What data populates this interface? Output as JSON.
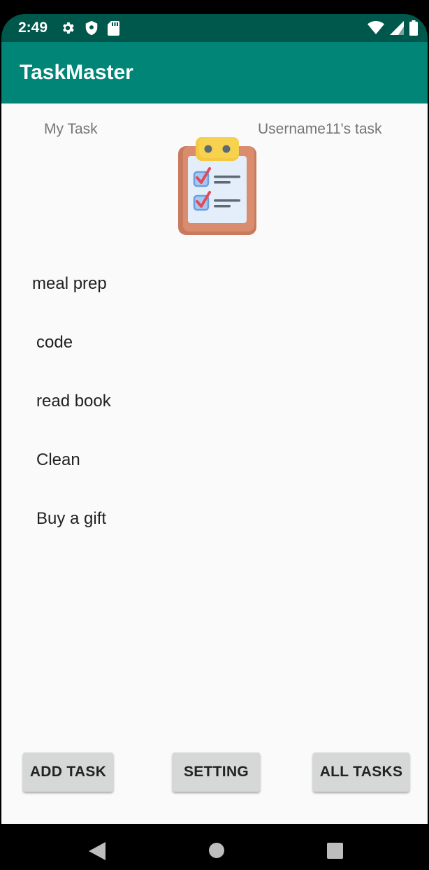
{
  "status_bar": {
    "time": "2:49",
    "icons_left": [
      "gear-icon",
      "shield-icon",
      "sd-card-icon"
    ],
    "icons_right": [
      "wifi-icon",
      "cell-signal-icon",
      "battery-icon"
    ]
  },
  "app_bar": {
    "title": "TaskMaster"
  },
  "header": {
    "my_task_label": "My Task",
    "user_task_label": "Username11's task",
    "image_icon": "clipboard-checklist-icon"
  },
  "tasks": [
    "meal prep",
    "code",
    "read book",
    "Clean",
    "Buy a gift"
  ],
  "buttons": {
    "add_task": "ADD TASK",
    "setting": "SETTING",
    "all_tasks": "ALL TASKS"
  },
  "nav_bar": {
    "icons": [
      "back-icon",
      "home-icon",
      "recents-icon"
    ]
  },
  "colors": {
    "primary": "#008577",
    "primary_dark": "#00574b",
    "background": "#fafafa",
    "button": "#d6d7d7"
  }
}
